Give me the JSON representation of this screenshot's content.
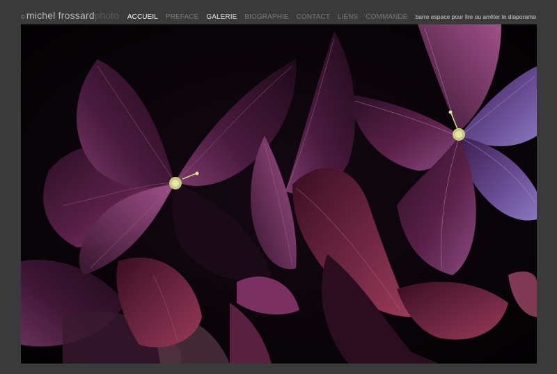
{
  "header": {
    "copyright_symbol": "©",
    "brand_name": "michel frossard",
    "brand_suffix": "photo",
    "hint": "barre espace pour lire ou arrêter le diaporama"
  },
  "nav": {
    "items": [
      {
        "label": "ACCUEIL",
        "state": "active"
      },
      {
        "label": "PREFACE",
        "state": "dim"
      },
      {
        "label": "GALERIE",
        "state": "bright"
      },
      {
        "label": "BIOGRAPHIE",
        "state": "dim"
      },
      {
        "label": "CONTACT",
        "state": "dim"
      },
      {
        "label": "LIENS",
        "state": "dim"
      },
      {
        "label": "COMMANDE",
        "state": "dim"
      }
    ]
  },
  "slideshow": {
    "subject": "dark purple hydrangea flowers",
    "colors": {
      "background": "#050305",
      "petal_dark": "#3a1430",
      "petal_mid": "#6b2a55",
      "petal_light": "#8a4a80",
      "petal_blue": "#6a5aa0",
      "stamen": "#d8d890"
    }
  }
}
